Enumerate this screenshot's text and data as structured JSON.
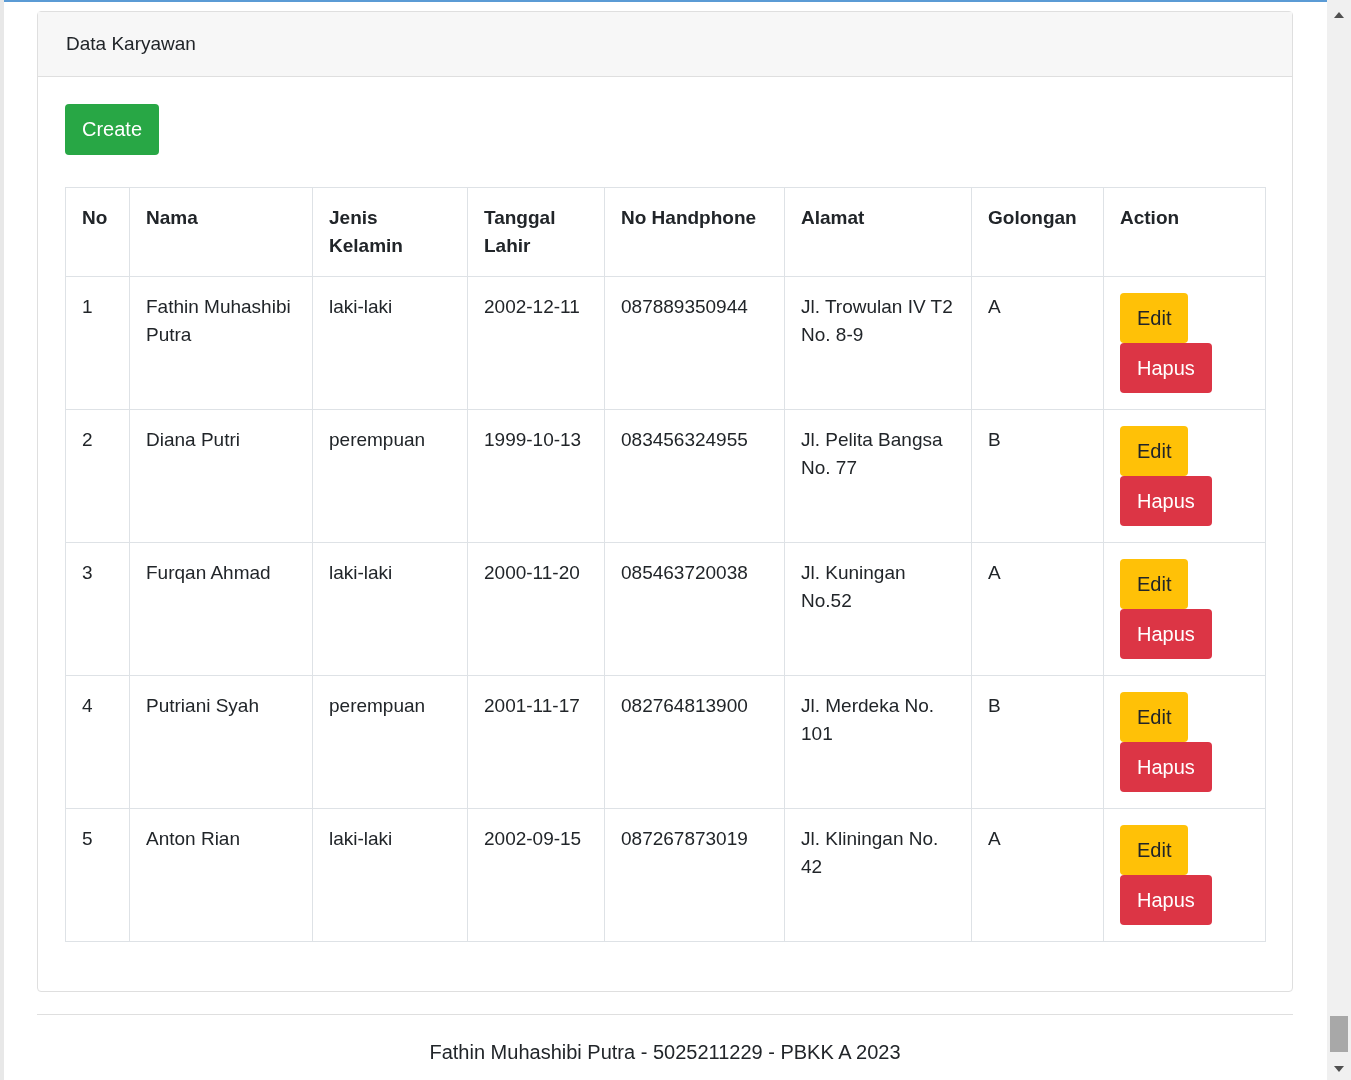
{
  "card": {
    "title": "Data Karyawan"
  },
  "create_button": "Create",
  "table": {
    "columns": [
      "No",
      "Nama",
      "Jenis Kelamin",
      "Tanggal Lahir",
      "No Handphone",
      "Alamat",
      "Golongan",
      "Action"
    ],
    "rows": [
      {
        "no": "1",
        "nama": "Fathin Muhashibi Putra",
        "jenis_kelamin": "laki-laki",
        "tanggal_lahir": "2002-12-11",
        "no_handphone": "087889350944",
        "alamat": "Jl. Trowulan IV T2 No. 8-9",
        "golongan": "A",
        "actions": [
          "Edit",
          "Hapus"
        ]
      },
      {
        "no": "2",
        "nama": "Diana Putri",
        "jenis_kelamin": "perempuan",
        "tanggal_lahir": "1999-10-13",
        "no_handphone": "083456324955",
        "alamat": "Jl. Pelita Bangsa No. 77",
        "golongan": "B",
        "actions": [
          "Edit",
          "Hapus"
        ]
      },
      {
        "no": "3",
        "nama": "Furqan Ahmad",
        "jenis_kelamin": "laki-laki",
        "tanggal_lahir": "2000-11-20",
        "no_handphone": "085463720038",
        "alamat": "Jl. Kuningan No.52",
        "golongan": "A",
        "actions": [
          "Edit",
          "Hapus"
        ]
      },
      {
        "no": "4",
        "nama": "Putriani Syah",
        "jenis_kelamin": "perempuan",
        "tanggal_lahir": "2001-11-17",
        "no_handphone": "082764813900",
        "alamat": "Jl. Merdeka No. 101",
        "golongan": "B",
        "actions": [
          "Edit",
          "Hapus"
        ]
      },
      {
        "no": "5",
        "nama": "Anton Rian",
        "jenis_kelamin": "laki-laki",
        "tanggal_lahir": "2002-09-15",
        "no_handphone": "087267873019",
        "alamat": "Jl. Kliningan No. 42",
        "golongan": "A",
        "actions": [
          "Edit",
          "Hapus"
        ]
      }
    ]
  },
  "footer": "Fathin Muhashibi Putra - 5025211229 - PBKK A 2023"
}
